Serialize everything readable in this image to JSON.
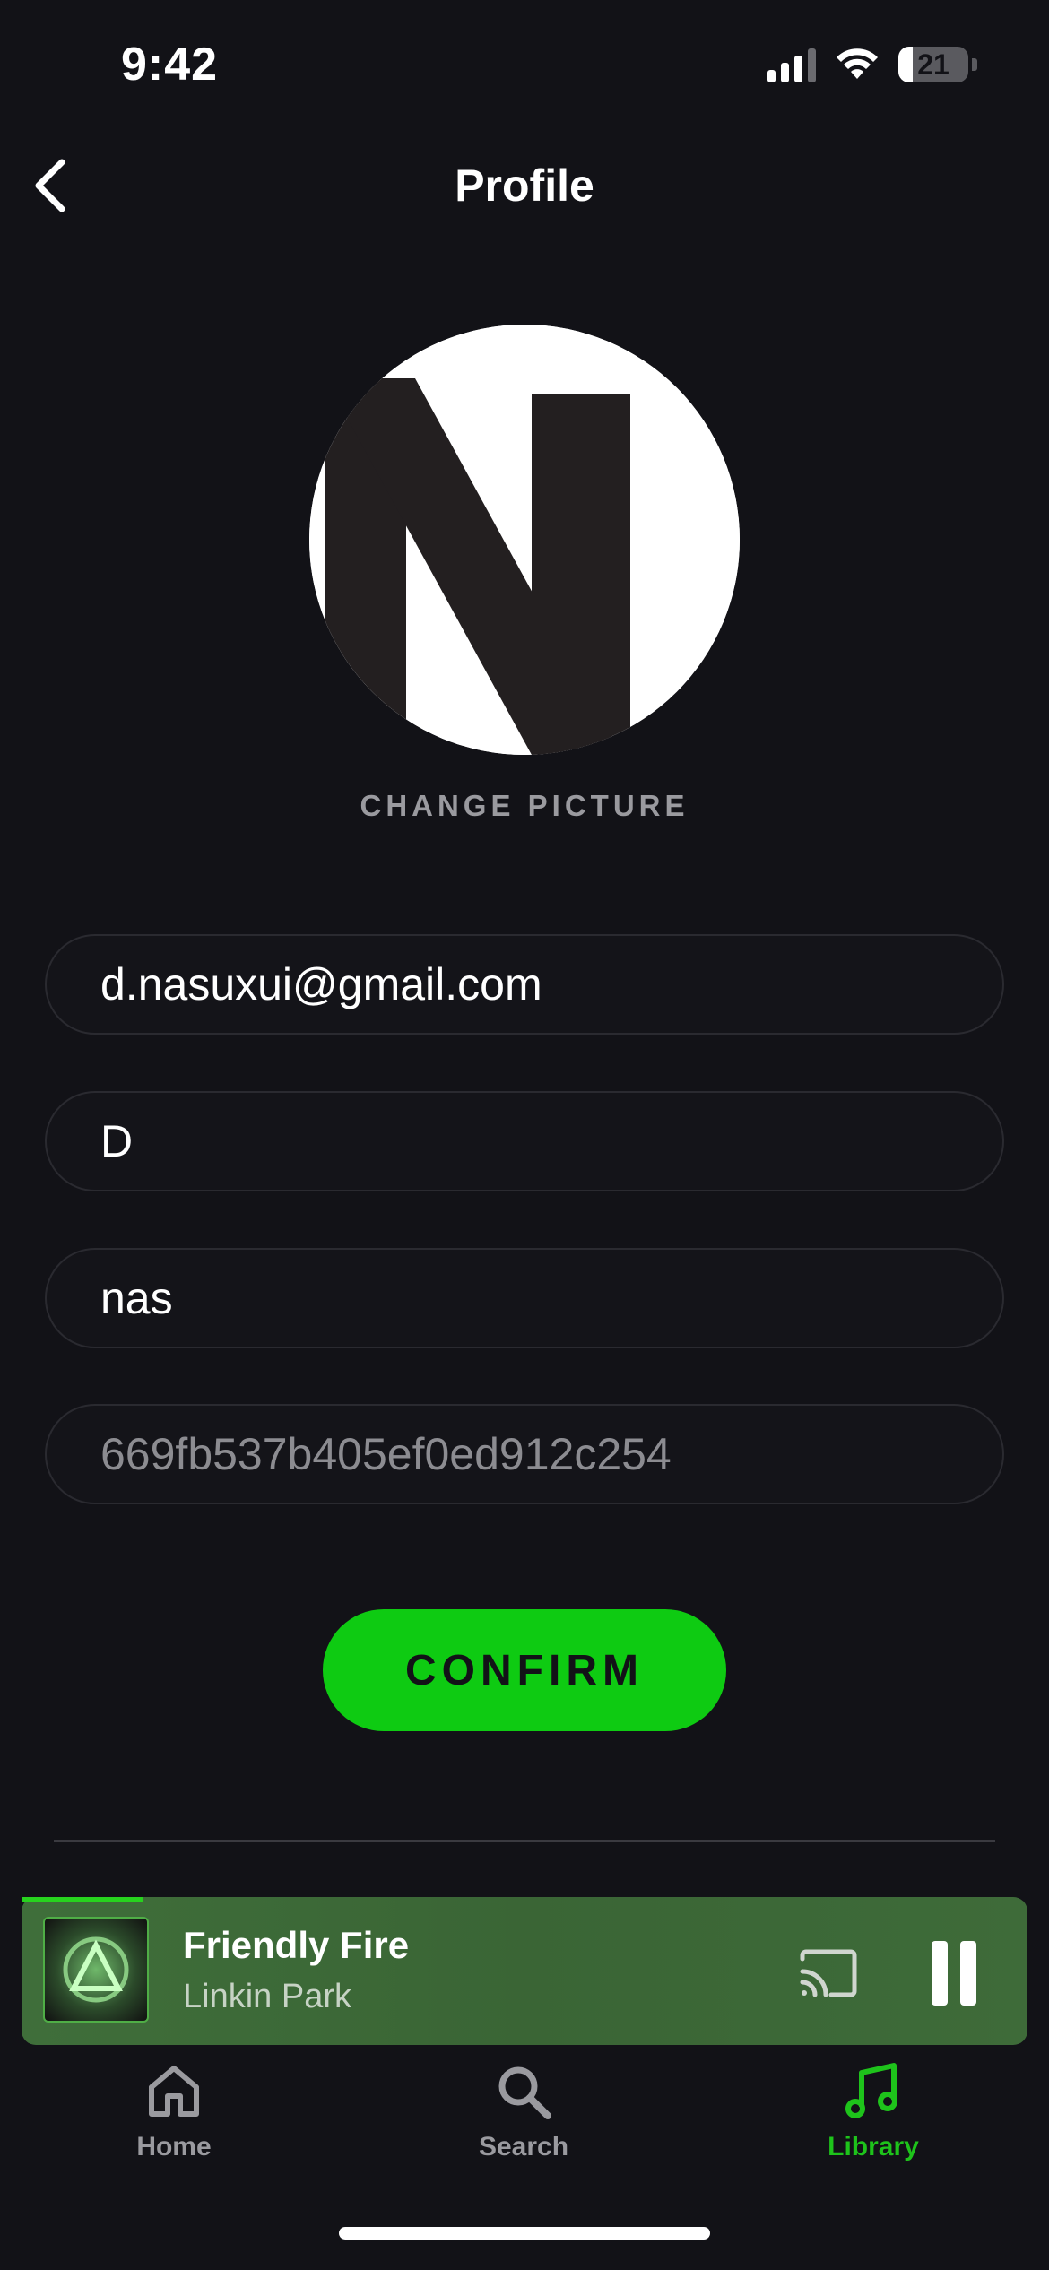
{
  "status_bar": {
    "time": "9:42",
    "battery": "21",
    "battery_level_percent": 21,
    "icons": [
      "cellular-signal-icon",
      "wifi-icon",
      "battery-icon"
    ]
  },
  "header": {
    "title": "Profile",
    "back_icon": "chevron-left-icon"
  },
  "profile": {
    "change_picture_label": "CHANGE PICTURE",
    "avatar_letter": "N"
  },
  "form": {
    "email": "d.nasuxui@gmail.com",
    "first_name": "D",
    "last_name": "nas",
    "user_id": "669fb537b405ef0ed912c254"
  },
  "actions": {
    "confirm_label": "CONFIRM"
  },
  "now_playing": {
    "title": "Friendly Fire",
    "artist": "Linkin Park",
    "progress_fraction": 0.12,
    "icons": [
      "cast-icon",
      "pause-icon"
    ]
  },
  "tab_bar": {
    "tabs": [
      {
        "label": "Home",
        "icon": "home-icon",
        "active": false
      },
      {
        "label": "Search",
        "icon": "search-icon",
        "active": false
      },
      {
        "label": "Library",
        "icon": "music-note-icon",
        "active": true
      }
    ]
  },
  "colors": {
    "background": "#121217",
    "accent_green": "#0ecb12",
    "player_green": "#3f6e3a",
    "active_tab": "#1ec31b",
    "inactive_tab": "#9a9a9f"
  }
}
